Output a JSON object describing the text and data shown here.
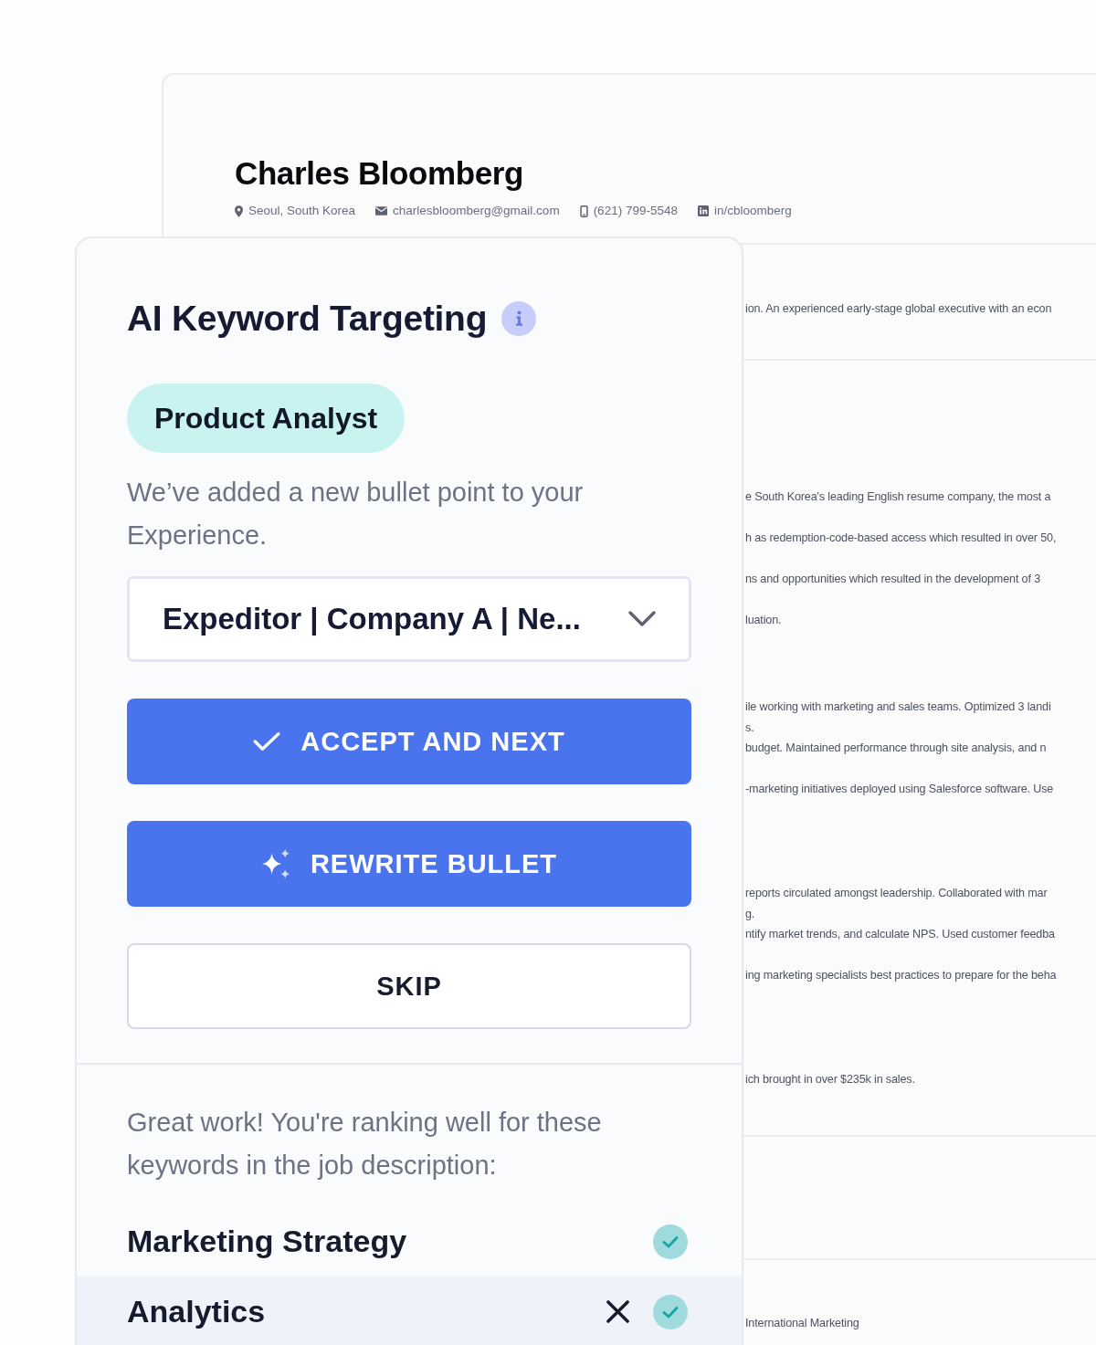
{
  "resume": {
    "name": "Charles Bloomberg",
    "contacts": [
      {
        "kind": "location",
        "text": "Seoul, South Korea"
      },
      {
        "kind": "email",
        "text": "charlesbloomberg@gmail.com"
      },
      {
        "kind": "phone",
        "text": "(621) 799-5548"
      },
      {
        "kind": "linkedin",
        "text": "in/cbloomberg"
      }
    ],
    "summary": "ion. An experienced early-stage global executive with an econ",
    "experience": [
      {
        "bullets": [
          [
            "e South Korea's leading English resume company, the most a"
          ],
          [
            "h as redemption-code-based access which resulted in over 50,"
          ],
          [
            "ns and opportunities which resulted in the development of 3"
          ],
          [
            "luation."
          ]
        ]
      },
      {
        "bullets": [
          [
            "ile working with marketing and sales teams. Optimized 3 landi",
            "s."
          ],
          [
            "budget. Maintained performance through site analysis, and n"
          ],
          [
            "-marketing initiatives deployed using Salesforce software. Use"
          ]
        ]
      },
      {
        "bullets": [
          [
            "reports circulated amongst leadership. Collaborated with mar",
            "g."
          ],
          [
            "ntify market trends, and calculate NPS. Used customer feedba"
          ],
          [
            "ing marketing specialists best practices to prepare for the beha"
          ]
        ]
      },
      {
        "bullets": [
          [
            "ich brought in over $235k in sales."
          ]
        ]
      }
    ],
    "skills": [
      "International Marketing"
    ]
  },
  "panel": {
    "title": "AI Keyword Targeting",
    "job_title": "Product Analyst",
    "message": "We’ve added a new bullet point to your Experience.",
    "dropdown": {
      "value": "Expeditor | Company A | Ne..."
    },
    "buttons": [
      {
        "kind": "accept",
        "label": "ACCEPT AND NEXT"
      },
      {
        "kind": "rewrite",
        "label": "REWRITE BULLET"
      },
      {
        "kind": "skip",
        "label": "SKIP"
      }
    ],
    "keywords_intro": "Great work! You're ranking well for these keywords in the job description:",
    "keywords": [
      {
        "label": "Marketing Strategy",
        "matched": true,
        "selected": false
      },
      {
        "label": "Analytics",
        "matched": true,
        "selected": true
      }
    ]
  }
}
